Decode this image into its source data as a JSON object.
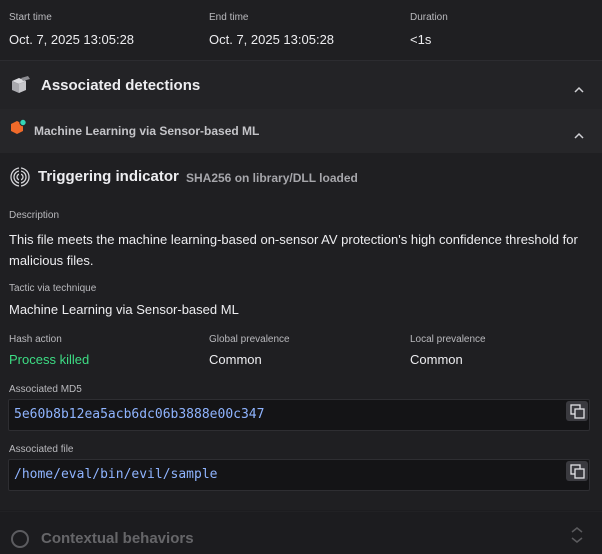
{
  "summary": {
    "start_label": "Start time",
    "start_value": "Oct. 7, 2025 13:05:28",
    "end_label": "End time",
    "end_value": "Oct. 7, 2025 13:05:28",
    "duration_label": "Duration",
    "duration_value": "<1s"
  },
  "associated_detections": {
    "title": "Associated detections"
  },
  "detection": {
    "name": "Machine Learning via Sensor-based ML"
  },
  "triggering": {
    "title": "Triggering indicator",
    "subtitle": "SHA256 on library/DLL loaded",
    "description_label": "Description",
    "description": "This file meets the machine learning-based on-sensor AV protection's high confidence threshold for malicious files.",
    "tactic_label": "Tactic via technique",
    "tactic_value": "Machine Learning via Sensor-based ML",
    "hash_action_label": "Hash action",
    "hash_action_value": "Process killed",
    "global_prev_label": "Global prevalence",
    "global_prev_value": "Common",
    "local_prev_label": "Local prevalence",
    "local_prev_value": "Common",
    "md5_label": "Associated MD5",
    "md5_value": "5e60b8b12ea5acb6dc06b3888e00c347",
    "file_label": "Associated file",
    "file_value": "/home/eval/bin/evil/sample"
  },
  "contextual": {
    "title": "Contextual behaviors"
  },
  "colors": {
    "success": "#3ddc84",
    "link_mono": "#8fb4ff",
    "accent_orange": "#f06a2a",
    "accent_teal": "#33d6b8"
  },
  "icons": [
    "cubes-icon",
    "hexagon-icon",
    "fingerprint-icon",
    "chevron-up-icon",
    "copy-icon"
  ]
}
